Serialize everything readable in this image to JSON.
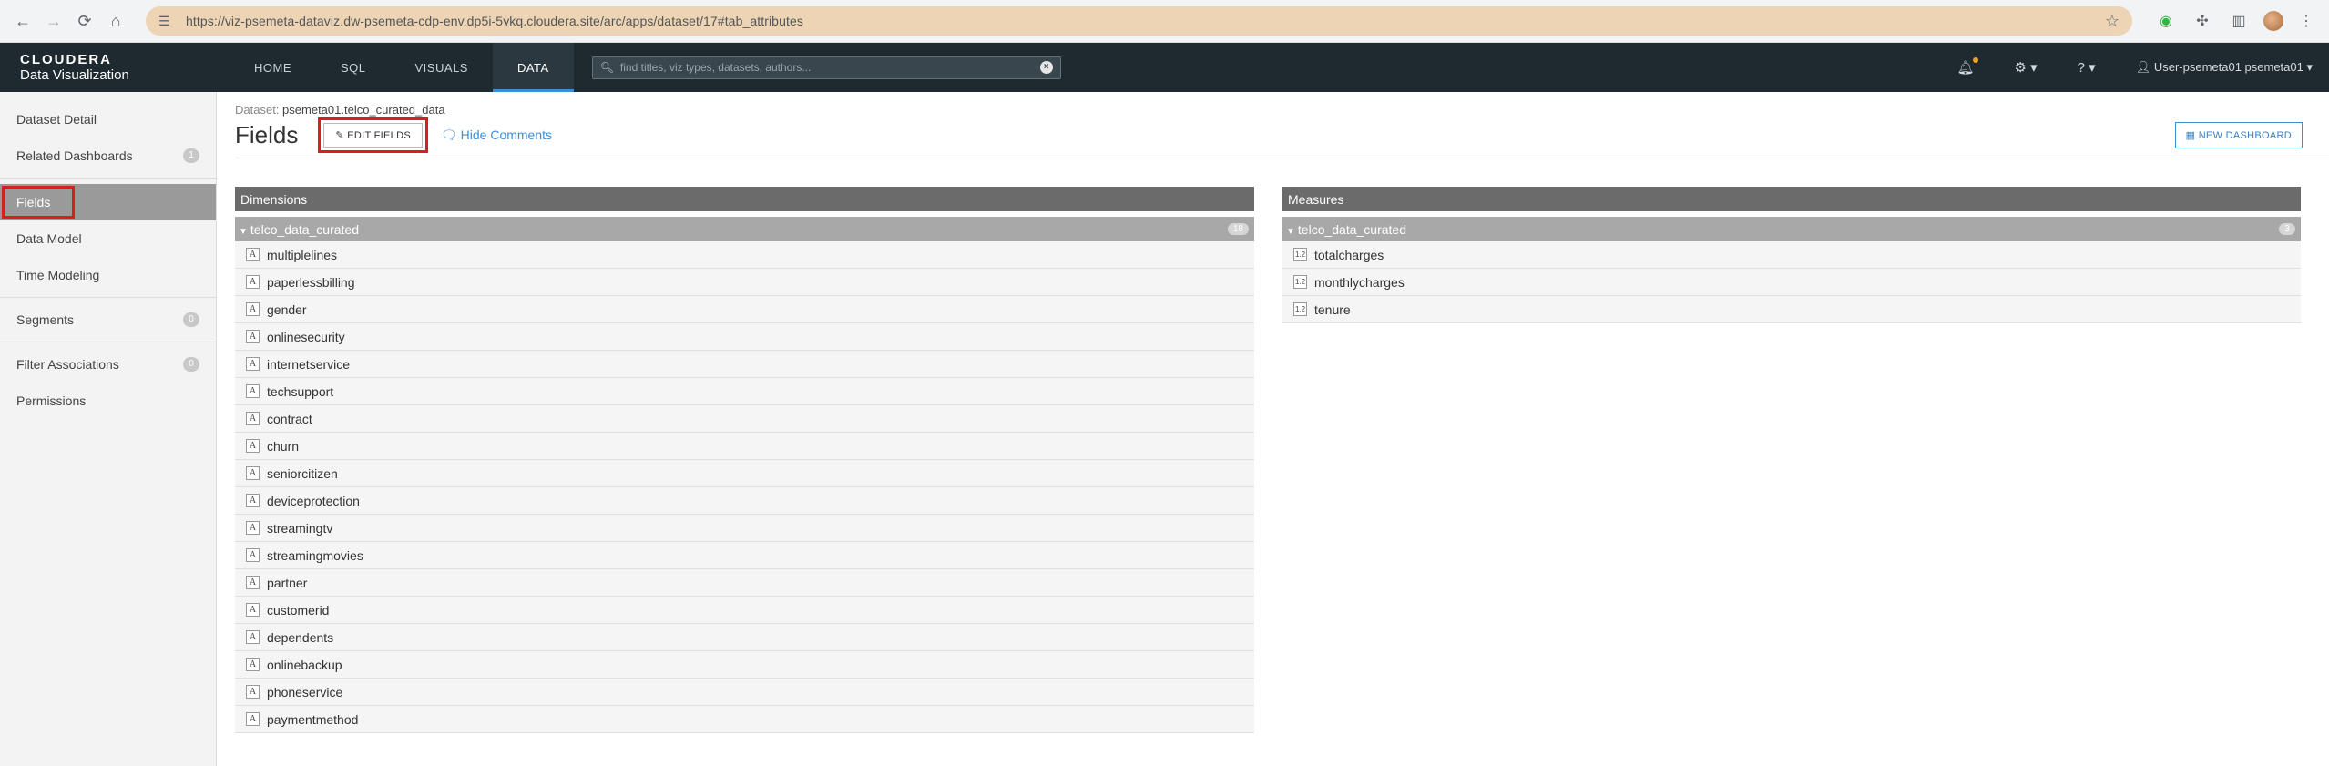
{
  "browser": {
    "url": "https://viz-psemeta-dataviz.dw-psemeta-cdp-env.dp5i-5vkq.cloudera.site/arc/apps/dataset/17#tab_attributes"
  },
  "app": {
    "logo_line1": "CLOUDERA",
    "logo_line2": "Data Visualization",
    "nav": [
      {
        "label": "HOME"
      },
      {
        "label": "SQL"
      },
      {
        "label": "VISUALS"
      },
      {
        "label": "DATA"
      }
    ],
    "search_placeholder": "find titles, viz types, datasets, authors...",
    "user_label": "User-psemeta01 psemeta01"
  },
  "sidebar": {
    "items": [
      {
        "label": "Dataset Detail",
        "badge": ""
      },
      {
        "label": "Related Dashboards",
        "badge": "1"
      },
      {
        "label": "Fields",
        "badge": ""
      },
      {
        "label": "Data Model",
        "badge": ""
      },
      {
        "label": "Time Modeling",
        "badge": ""
      },
      {
        "label": "Segments",
        "badge": "0"
      },
      {
        "label": "Filter Associations",
        "badge": "0"
      },
      {
        "label": "Permissions",
        "badge": ""
      }
    ]
  },
  "header": {
    "crumb_prefix": "Dataset:",
    "dataset_name": "psemeta01.telco_curated_data",
    "title": "Fields",
    "edit_label": "EDIT FIELDS",
    "hide_comments": "Hide Comments",
    "new_dashboard": "NEW DASHBOARD"
  },
  "dimensions": {
    "title": "Dimensions",
    "table": "telco_data_curated",
    "count": "18",
    "type_icon": "A",
    "fields": [
      "multiplelines",
      "paperlessbilling",
      "gender",
      "onlinesecurity",
      "internetservice",
      "techsupport",
      "contract",
      "churn",
      "seniorcitizen",
      "deviceprotection",
      "streamingtv",
      "streamingmovies",
      "partner",
      "customerid",
      "dependents",
      "onlinebackup",
      "phoneservice",
      "paymentmethod"
    ]
  },
  "measures": {
    "title": "Measures",
    "table": "telco_data_curated",
    "count": "3",
    "type_icon": "1.2",
    "fields": [
      "totalcharges",
      "monthlycharges",
      "tenure"
    ]
  },
  "colors": {
    "accent": "#3a8fd8",
    "header_bg": "#1f2a30",
    "highlight_red": "#d32020"
  }
}
